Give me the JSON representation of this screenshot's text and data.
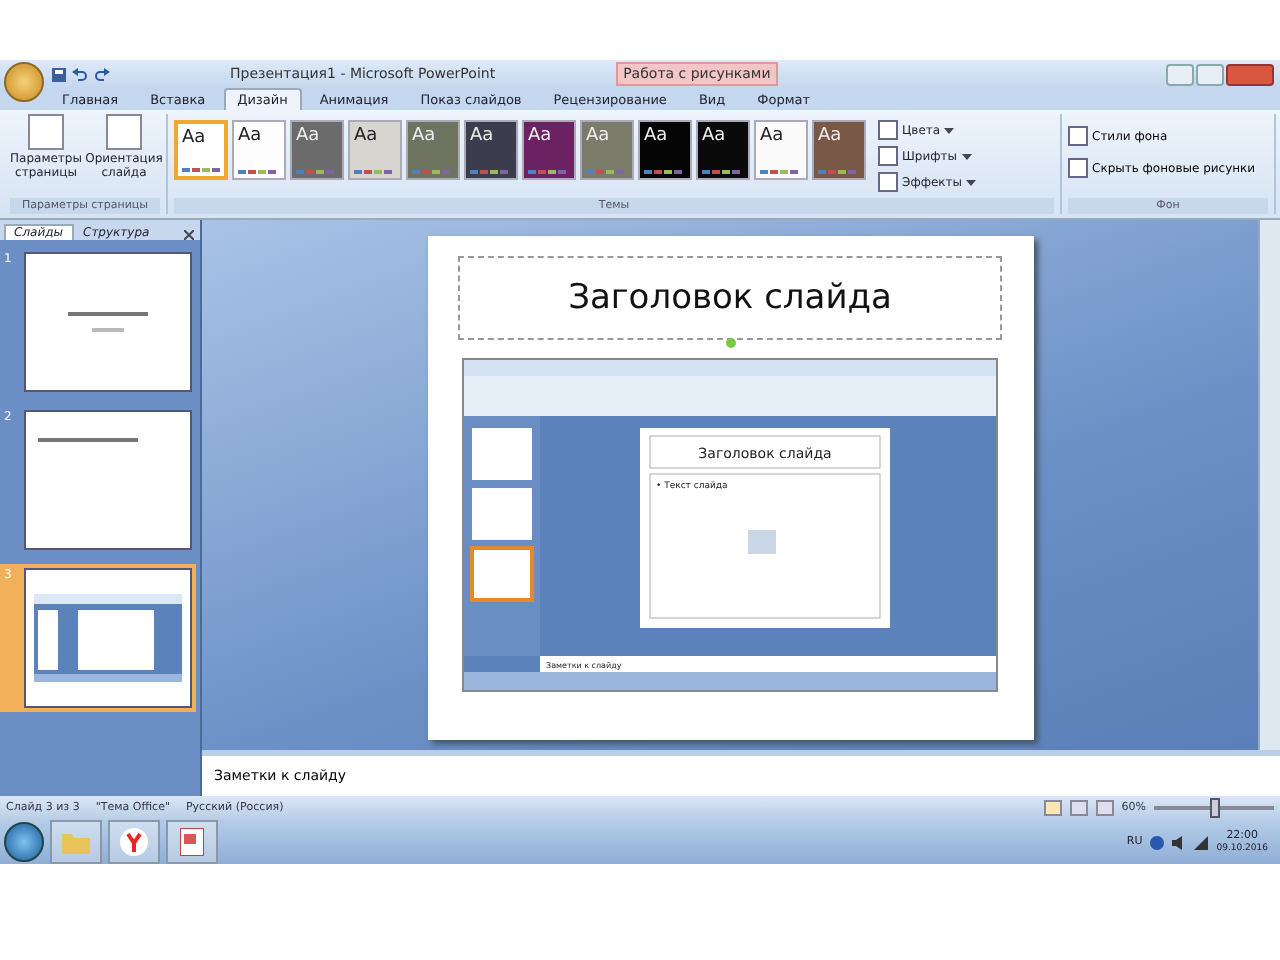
{
  "window": {
    "title": "Презентация1 - Microsoft PowerPoint",
    "context_tab": "Работа с рисунками"
  },
  "ribbon_tabs": [
    {
      "label": "Главная",
      "selected": false
    },
    {
      "label": "Вставка",
      "selected": false
    },
    {
      "label": "Дизайн",
      "selected": true
    },
    {
      "label": "Анимация",
      "selected": false
    },
    {
      "label": "Показ слайдов",
      "selected": false
    },
    {
      "label": "Рецензирование",
      "selected": false
    },
    {
      "label": "Вид",
      "selected": false
    },
    {
      "label": "Формат",
      "selected": false
    }
  ],
  "page_setup": {
    "buttons": [
      "Параметры страницы",
      "Ориентация слайда"
    ],
    "group": "Параметры страницы"
  },
  "themes": {
    "items": [
      {
        "label": "Aa",
        "color": "#ffffff",
        "selected": true
      },
      {
        "label": "Aa",
        "color": "#fdfdfd",
        "selected": false
      },
      {
        "label": "Aa",
        "color": "#6b6b6b",
        "selected": false
      },
      {
        "label": "Aa",
        "color": "#d8d4d0",
        "selected": false
      },
      {
        "label": "Aa",
        "color": "#6f7460",
        "selected": false
      },
      {
        "label": "Aa",
        "color": "#3c3d4c",
        "selected": false
      },
      {
        "label": "Aa",
        "color": "#6a2262",
        "selected": false
      },
      {
        "label": "Aa",
        "color": "#7b7b6a",
        "selected": false
      },
      {
        "label": "Aa",
        "color": "#050505",
        "selected": false
      },
      {
        "label": "Aa",
        "color": "#0a0a0a",
        "selected": false
      },
      {
        "label": "Aa",
        "color": "#fafafa",
        "selected": false
      },
      {
        "label": "Aa",
        "color": "#7a5848",
        "selected": false
      }
    ],
    "options": [
      "Цвета",
      "Шрифты",
      "Эффекты"
    ],
    "group": "Темы"
  },
  "background": {
    "options": [
      "Стили фона",
      "Скрыть фоновые рисунки"
    ],
    "group": "Фон"
  },
  "pane_tabs": [
    {
      "label": "Слайды",
      "selected": true
    },
    {
      "label": "Структура",
      "selected": false
    }
  ],
  "slides": [
    {
      "number": "1",
      "selected": false
    },
    {
      "number": "2",
      "selected": false
    },
    {
      "number": "3",
      "selected": true
    }
  ],
  "slide": {
    "title": "Заголовок слайда",
    "picture": {
      "title": "Заголовок слайда",
      "bullet": "• Текст слайда",
      "notes": "Заметки к слайду"
    }
  },
  "notes": "Заметки к слайду",
  "status_bar": {
    "slide": "Слайд 3 из 3",
    "theme": "\"Тема Office\"",
    "language": "Русский (Россия)",
    "zoom": "60%",
    "level": 0.5
  },
  "taskbar": {
    "language": "RU",
    "time": "22:00",
    "date": "09.10.2016"
  }
}
